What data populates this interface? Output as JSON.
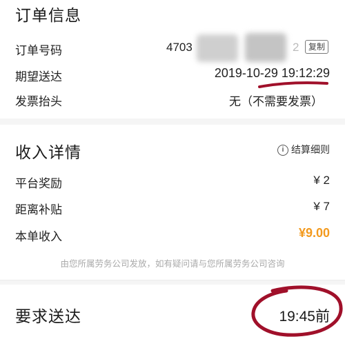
{
  "order_section": {
    "title": "订单信息",
    "order_no_label": "订单号码",
    "order_no_value": "4703",
    "order_no_tail": "2",
    "copy_label": "复制",
    "expected_label": "期望送达",
    "expected_value": "2019-10-29 19:12:29",
    "invoice_label": "发票抬头",
    "invoice_value": "无（不需要发票）"
  },
  "income_section": {
    "title": "收入详情",
    "detail_link": "结算细则",
    "detail_icon": "info-icon",
    "rows": [
      {
        "label": "平台奖励",
        "value": "¥ 2"
      },
      {
        "label": "距离补贴",
        "value": "¥ 7"
      }
    ],
    "total_label": "本单收入",
    "total_value": "¥9.00",
    "total_color": "#f39a1e",
    "note": "由您所属劳务公司发放，如有疑问请与您所属劳务公司咨询"
  },
  "deliver_section": {
    "label": "要求送达",
    "value": "19:45前"
  },
  "annotations": {
    "ink_color": "#a0102a"
  }
}
